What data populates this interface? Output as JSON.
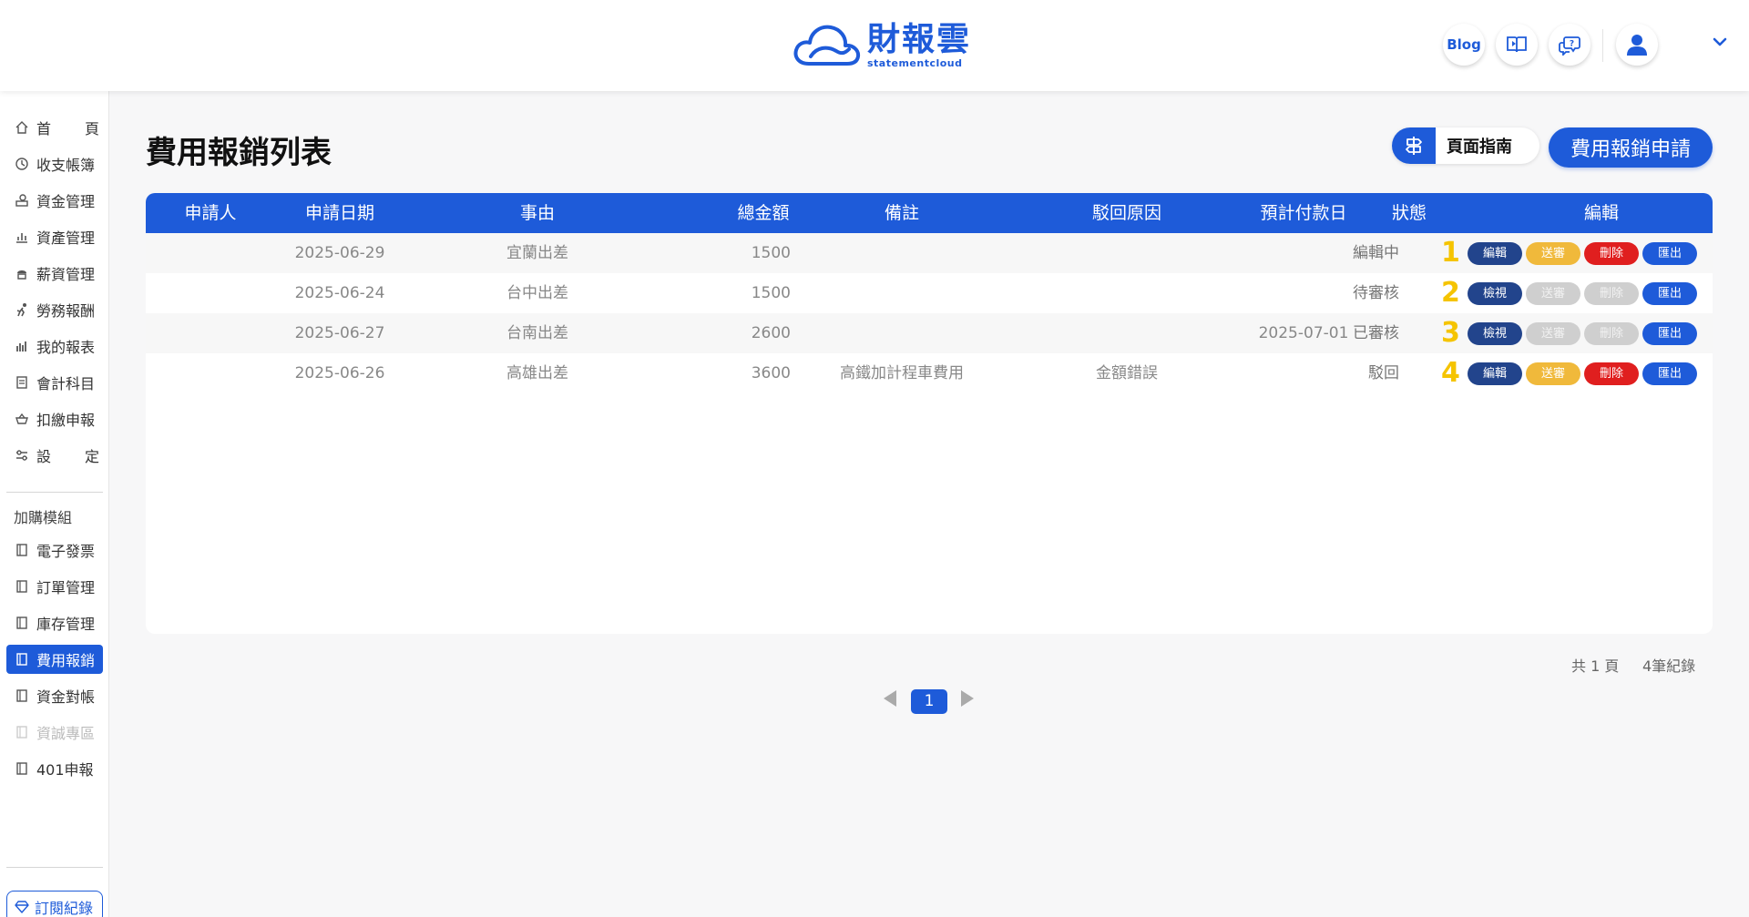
{
  "header": {
    "logo_zh": "財報雲",
    "logo_en": "statementcloud",
    "blog_label": "Blog"
  },
  "sidebar": {
    "items": [
      {
        "label": "首 頁"
      },
      {
        "label": "收支帳簿"
      },
      {
        "label": "資金管理"
      },
      {
        "label": "資產管理"
      },
      {
        "label": "薪資管理"
      },
      {
        "label": "勞務報酬"
      },
      {
        "label": "我的報表"
      },
      {
        "label": "會計科目"
      },
      {
        "label": "扣繳申報"
      },
      {
        "label": "設 定"
      }
    ],
    "section_label": "加購模組",
    "modules": [
      {
        "label": "電子發票"
      },
      {
        "label": "訂單管理"
      },
      {
        "label": "庫存管理"
      },
      {
        "label": "費用報銷"
      },
      {
        "label": "資金對帳"
      },
      {
        "label": "資誠專區"
      },
      {
        "label": "401申報"
      }
    ],
    "subscription_label": "訂閱紀錄"
  },
  "main": {
    "title": "費用報銷列表",
    "guide_label": "頁面指南",
    "apply_label": "費用報銷申請"
  },
  "table": {
    "headers": [
      "申請人",
      "申請日期",
      "事由",
      "總金額",
      "備註",
      "駁回原因",
      "預計付款日",
      "狀態",
      "編輯"
    ],
    "rows": [
      {
        "applicant": "",
        "date": "2025-06-29",
        "reason": "宜蘭出差",
        "amount": "1500",
        "note": "",
        "reject": "",
        "pay_date": "",
        "status": "編輯中",
        "marker": "1",
        "buttons": [
          "編輯",
          "送審",
          "刪除",
          "匯出"
        ]
      },
      {
        "applicant": "",
        "date": "2025-06-24",
        "reason": "台中出差",
        "amount": "1500",
        "note": "",
        "reject": "",
        "pay_date": "",
        "status": "待審核",
        "marker": "2",
        "buttons": [
          "檢視",
          "送審",
          "刪除",
          "匯出"
        ]
      },
      {
        "applicant": "",
        "date": "2025-06-27",
        "reason": "台南出差",
        "amount": "2600",
        "note": "",
        "reject": "",
        "pay_date": "2025-07-01",
        "status": "已審核",
        "marker": "3",
        "buttons": [
          "檢視",
          "送審",
          "刪除",
          "匯出"
        ]
      },
      {
        "applicant": "",
        "date": "2025-06-26",
        "reason": "高雄出差",
        "amount": "3600",
        "note": "高鐵加計程車費用",
        "reject": "金額錯誤",
        "pay_date": "",
        "status": "駁回",
        "marker": "4",
        "buttons": [
          "編輯",
          "送審",
          "刪除",
          "匯出"
        ]
      }
    ]
  },
  "footer": {
    "total_pages": "共 1 頁",
    "total_records": "4筆紀錄",
    "current_page": "1"
  },
  "colors": {
    "primary": "#1e5bd9",
    "navy": "#22448c",
    "yellow": "#f0b93b",
    "red": "#e01f1f",
    "disabled": "#cfcfcf",
    "marker": "#f5c400"
  }
}
